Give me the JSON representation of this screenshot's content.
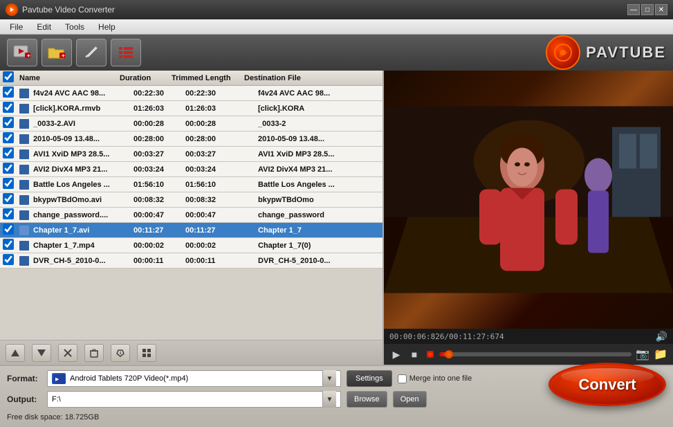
{
  "titlebar": {
    "title": "Pavtube Video Converter",
    "min_btn": "—",
    "max_btn": "□",
    "close_btn": "✕"
  },
  "menu": {
    "items": [
      "File",
      "Edit",
      "Tools",
      "Help"
    ]
  },
  "toolbar": {
    "add_video_label": "Add Video",
    "add_folder_label": "Add Folder",
    "edit_label": "Edit",
    "list_label": "List"
  },
  "logo": {
    "text": "PAVTUBE"
  },
  "table": {
    "headers": [
      "",
      "Name",
      "Duration",
      "Trimmed Length",
      "Destination File"
    ],
    "rows": [
      {
        "checked": true,
        "name": "f4v24 AVC AAC 98...",
        "duration": "00:22:30",
        "trimmed": "00:22:30",
        "dest": "f4v24 AVC AAC 98...",
        "selected": false
      },
      {
        "checked": true,
        "name": "[click].KORA.rmvb",
        "duration": "01:26:03",
        "trimmed": "01:26:03",
        "dest": "[click].KORA",
        "selected": false
      },
      {
        "checked": true,
        "name": "_0033-2.AVI",
        "duration": "00:00:28",
        "trimmed": "00:00:28",
        "dest": "_0033-2",
        "selected": false
      },
      {
        "checked": true,
        "name": "2010-05-09 13.48...",
        "duration": "00:28:00",
        "trimmed": "00:28:00",
        "dest": "2010-05-09 13.48...",
        "selected": false
      },
      {
        "checked": true,
        "name": "AVI1 XviD MP3 28.5...",
        "duration": "00:03:27",
        "trimmed": "00:03:27",
        "dest": "AVI1 XviD MP3 28.5...",
        "selected": false
      },
      {
        "checked": true,
        "name": "AVI2 DivX4 MP3 21...",
        "duration": "00:03:24",
        "trimmed": "00:03:24",
        "dest": "AVI2 DivX4 MP3 21...",
        "selected": false
      },
      {
        "checked": true,
        "name": "Battle Los Angeles ...",
        "duration": "01:56:10",
        "trimmed": "01:56:10",
        "dest": "Battle Los Angeles ...",
        "selected": false
      },
      {
        "checked": true,
        "name": "bkypwTBdOmo.avi",
        "duration": "00:08:32",
        "trimmed": "00:08:32",
        "dest": "bkypwTBdOmo",
        "selected": false
      },
      {
        "checked": true,
        "name": "change_password....",
        "duration": "00:00:47",
        "trimmed": "00:00:47",
        "dest": "change_password",
        "selected": false
      },
      {
        "checked": true,
        "name": "Chapter 1_7.avi",
        "duration": "00:11:27",
        "trimmed": "00:11:27",
        "dest": "Chapter 1_7",
        "selected": true
      },
      {
        "checked": true,
        "name": "Chapter 1_7.mp4",
        "duration": "00:00:02",
        "trimmed": "00:00:02",
        "dest": "Chapter 1_7(0)",
        "selected": false
      },
      {
        "checked": true,
        "name": "DVR_CH-5_2010-0...",
        "duration": "00:00:11",
        "trimmed": "00:00:11",
        "dest": "DVR_CH-5_2010-0...",
        "selected": false
      }
    ]
  },
  "list_toolbar": {
    "up_label": "↑",
    "down_label": "↓",
    "delete_label": "✕",
    "trash_label": "🗑",
    "info_label": "ℹ",
    "grid_label": "⊞"
  },
  "preview": {
    "time_current": "00:00:06:826",
    "time_total": "00:11:27:674"
  },
  "format": {
    "label": "Format:",
    "value": "Android Tablets 720P Video(*.mp4)",
    "settings_btn": "Settings",
    "merge_label": "Merge into one file"
  },
  "output": {
    "label": "Output:",
    "value": "F:\\",
    "browse_btn": "Browse",
    "open_btn": "Open"
  },
  "status": {
    "disk_space": "Free disk space: 18.725GB"
  },
  "convert": {
    "label": "Convert"
  }
}
